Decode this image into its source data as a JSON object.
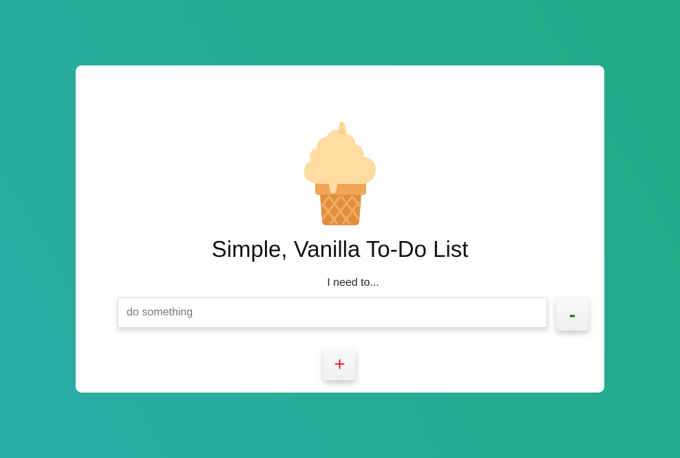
{
  "app": {
    "title": "Simple, Vanilla To-Do List",
    "logo_icon": "ice-cream-cone-icon"
  },
  "form": {
    "prompt_label": "I need to...",
    "input_value": "",
    "input_placeholder": "do something",
    "remove_label": "-",
    "add_label": "+"
  },
  "colors": {
    "background_start": "#2bada6",
    "background_end": "#21ab85",
    "card": "#ffffff",
    "ice_cream": "#fedca2",
    "cone": "#e08e3c",
    "remove_text": "#1f7a1f",
    "add_text": "#e02222"
  }
}
